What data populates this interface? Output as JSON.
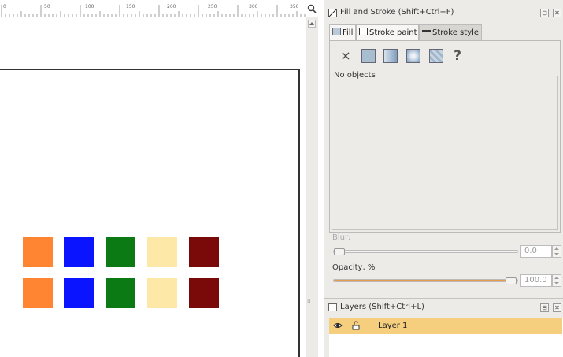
{
  "ruler": {
    "marks": [
      "0",
      "50",
      "100",
      "150",
      "200",
      "250",
      "300",
      "350"
    ]
  },
  "canvas": {
    "swatches": [
      {
        "color": "#ff8533"
      },
      {
        "color": "#0a14ff"
      },
      {
        "color": "#0b7a14"
      },
      {
        "color": "#fde8a8"
      },
      {
        "color": "#7a0a0a"
      },
      {
        "color": "#ff8533"
      },
      {
        "color": "#0a14ff"
      },
      {
        "color": "#0b7a14"
      },
      {
        "color": "#fde8a8"
      },
      {
        "color": "#7a0a0a"
      }
    ]
  },
  "fill_stroke": {
    "title": "Fill and Stroke (Shift+Ctrl+F)",
    "tabs": {
      "fill": "Fill",
      "stroke_paint": "Stroke paint",
      "stroke_style": "Stroke style"
    },
    "paint_buttons": [
      "no-paint",
      "flat-color",
      "linear-gradient",
      "radial-gradient",
      "pattern",
      "unset"
    ],
    "unset_glyph": "?",
    "none_glyph": "×",
    "no_objects": "No objects",
    "blur_label": "Blur:",
    "blur_value": "0.0",
    "opacity_label": "Opacity, %",
    "opacity_value": "100.0",
    "opacity_level": 1.0
  },
  "layers": {
    "title": "Layers (Shift+Ctrl+L)",
    "items": [
      {
        "name": "Layer 1",
        "visible": true,
        "locked": false
      }
    ]
  },
  "header_buttons": {
    "collapse": "⊟",
    "close": "✕"
  },
  "colors": {
    "selected_layer": "#f5cf7e",
    "opacity_track": "#e79b4a"
  }
}
